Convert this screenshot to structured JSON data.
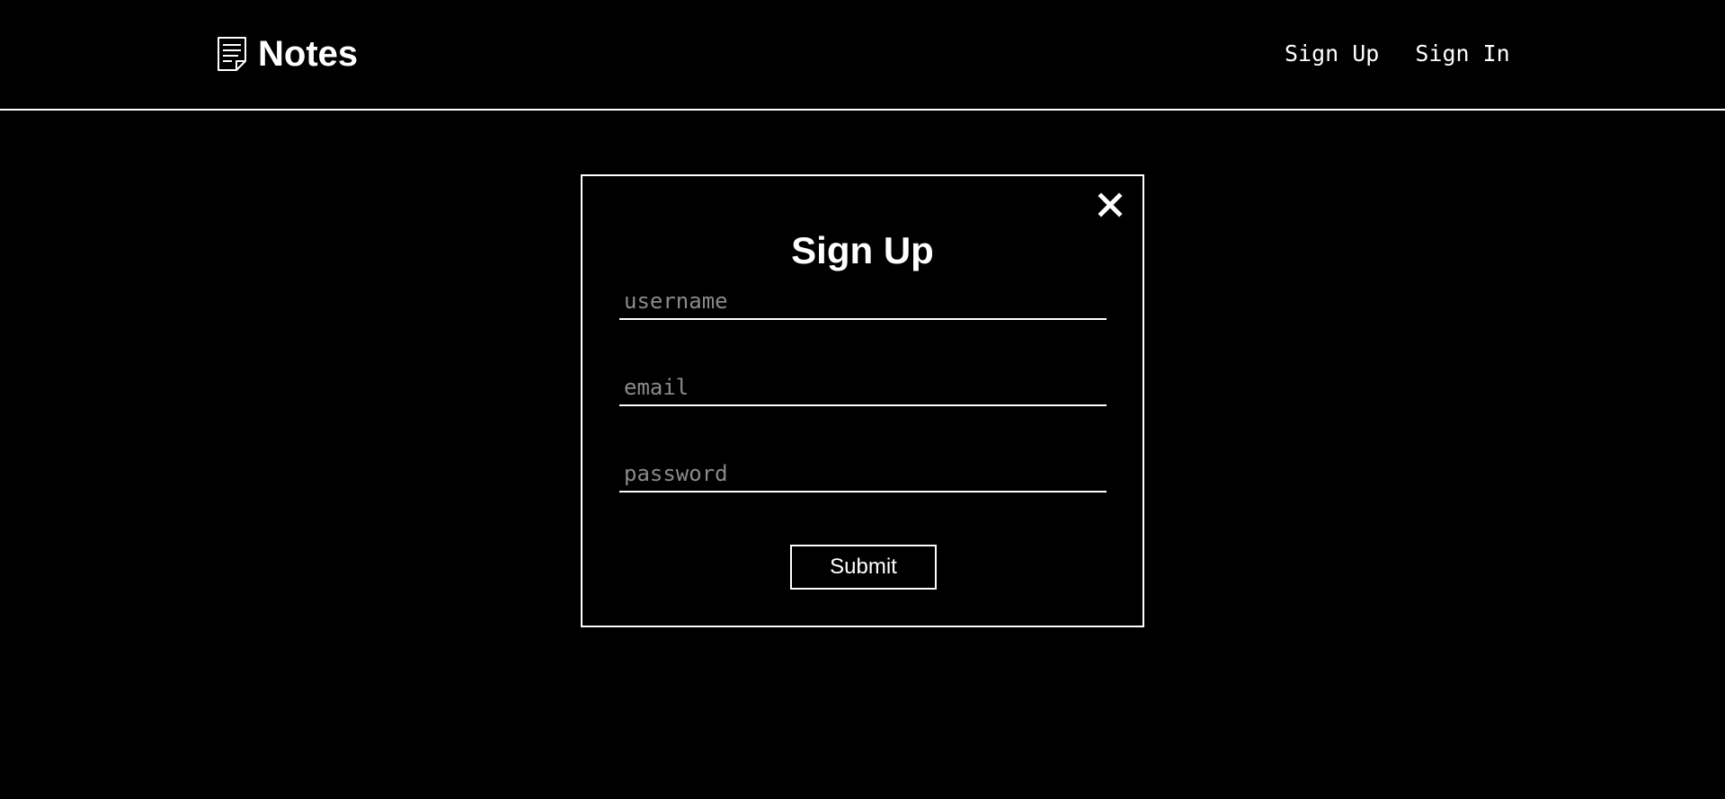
{
  "header": {
    "brand_icon": "note-icon",
    "brand_title": "Notes",
    "nav": {
      "sign_up_label": "Sign Up",
      "sign_in_label": "Sign In"
    }
  },
  "modal": {
    "close_icon": "close-icon",
    "title": "Sign Up",
    "fields": {
      "username_placeholder": "username",
      "username_value": "",
      "email_placeholder": "email",
      "email_value": "",
      "password_placeholder": "password",
      "password_value": ""
    },
    "submit_label": "Submit"
  },
  "colors": {
    "background": "#000000",
    "foreground": "#ffffff",
    "placeholder": "#8a8a8a"
  }
}
